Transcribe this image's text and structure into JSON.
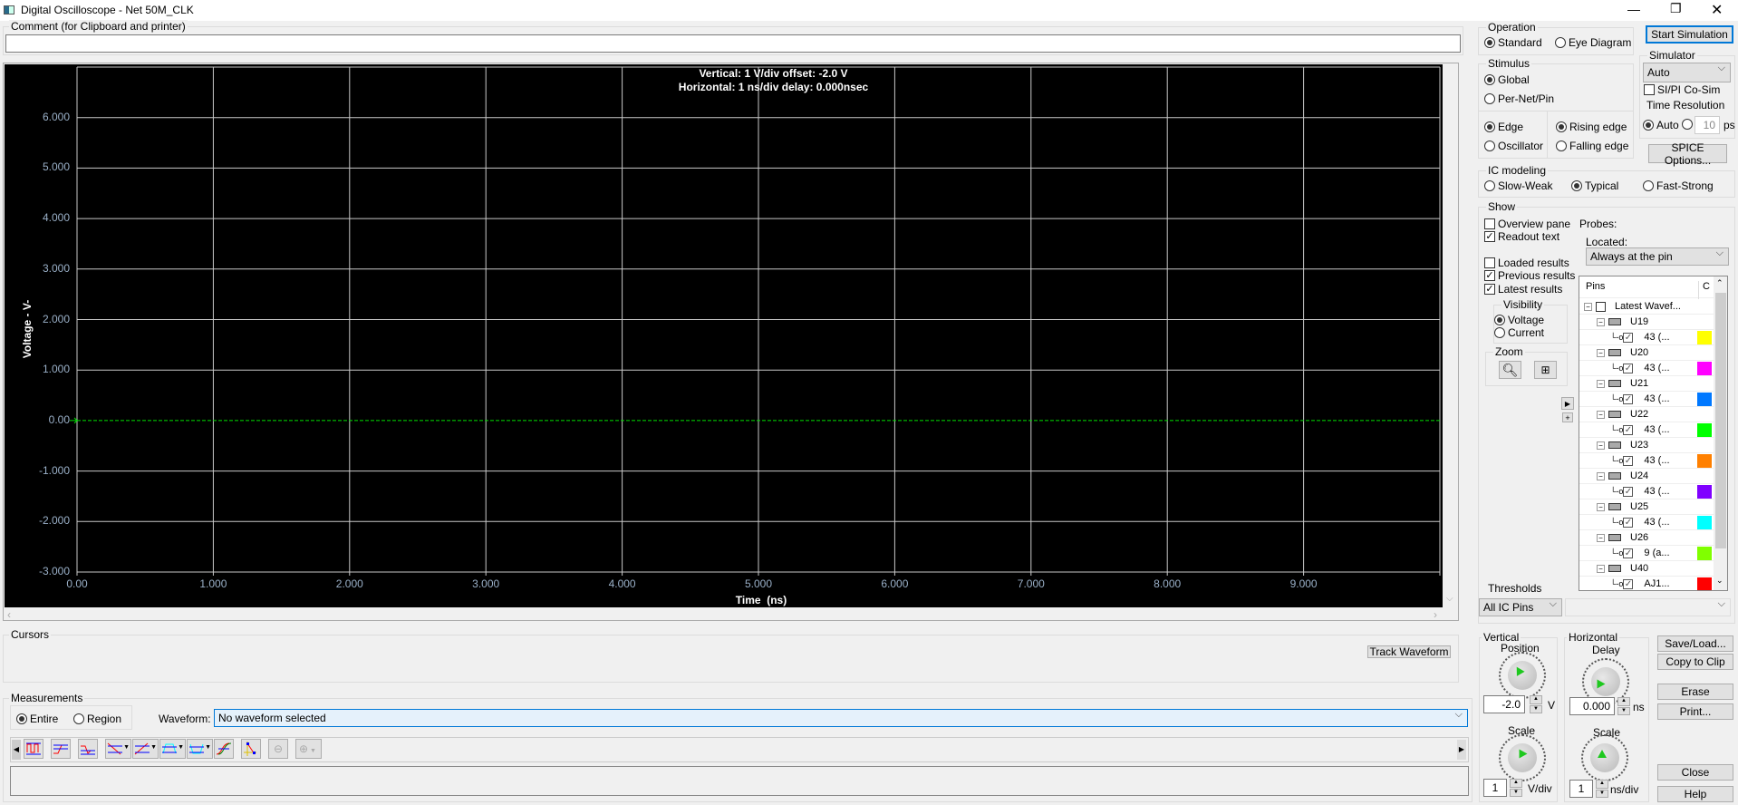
{
  "window": {
    "title": "Digital Oscilloscope - Net 50M_CLK"
  },
  "comment": {
    "label": "Comment (for Clipboard and printer)",
    "value": ""
  },
  "plot": {
    "readout_line1": "Vertical: 1  V/div  offset: -2.0 V",
    "readout_line2": "Horizontal: 1 ns/div  delay: 0.000nsec",
    "trace_color": "#00e000"
  },
  "chart_data": {
    "type": "line",
    "title": "",
    "xlabel": "Time  (ns)",
    "ylabel": "Voltage  - V-",
    "xlim": [
      0,
      10
    ],
    "ylim": [
      -3,
      7
    ],
    "x_ticks": [
      "0.00",
      "1.000",
      "2.000",
      "3.000",
      "4.000",
      "5.000",
      "6.000",
      "7.000",
      "8.000",
      "9.000"
    ],
    "y_ticks": [
      {
        "v": 6,
        "label": "6.000"
      },
      {
        "v": 5,
        "label": "5.000"
      },
      {
        "v": 4,
        "label": "4.000"
      },
      {
        "v": 3,
        "label": "3.000"
      },
      {
        "v": 2,
        "label": "2.000"
      },
      {
        "v": 1,
        "label": "1.000"
      },
      {
        "v": 0,
        "label": "0.00"
      },
      {
        "v": -1,
        "label": "-1.000"
      },
      {
        "v": -2,
        "label": "-2.000"
      },
      {
        "v": -3,
        "label": "-3.000"
      }
    ],
    "series": [
      {
        "name": "ground marker",
        "x": [
          0,
          10
        ],
        "y": [
          0,
          0
        ]
      }
    ],
    "grid": true
  },
  "operation": {
    "label": "Operation",
    "standard": "Standard",
    "eye": "Eye Diagram",
    "start": "Start Simulation"
  },
  "stimulus": {
    "label": "Stimulus",
    "global": "Global",
    "pernet": "Per-Net/Pin",
    "edge": "Edge",
    "osc": "Oscillator",
    "rising": "Rising edge",
    "falling": "Falling edge"
  },
  "simulator": {
    "label": "Simulator",
    "value": "Auto",
    "cosim": "SI/PI Co-Sim",
    "timeres": "Time Resolution",
    "auto": "Auto",
    "res_value": "10",
    "unit": "ps",
    "spice": "SPICE Options..."
  },
  "ic": {
    "label": "IC modeling",
    "slow": "Slow-Weak",
    "typ": "Typical",
    "fast": "Fast-Strong"
  },
  "show": {
    "label": "Show",
    "overview": "Overview pane",
    "readout": "Readout text",
    "loaded": "Loaded results",
    "previous": "Previous results",
    "latest": "Latest results",
    "probes": "Probes:",
    "located": "Located:",
    "located_value": "Always at the pin"
  },
  "visibility": {
    "label": "Visibility",
    "voltage": "Voltage",
    "current": "Current"
  },
  "zoom": {
    "label": "Zoom"
  },
  "tree": {
    "col_pins": "Pins",
    "col_c": "C",
    "root": "Latest Wavef...",
    "components": [
      {
        "name": "U19",
        "pin": "43 (...",
        "color": "#ffff00"
      },
      {
        "name": "U20",
        "pin": "43 (...",
        "color": "#ff00ff"
      },
      {
        "name": "U21",
        "pin": "43 (...",
        "color": "#0078ff"
      },
      {
        "name": "U22",
        "pin": "43 (...",
        "color": "#00ff00"
      },
      {
        "name": "U23",
        "pin": "43 (...",
        "color": "#ff8000"
      },
      {
        "name": "U24",
        "pin": "43 (...",
        "color": "#8000ff"
      },
      {
        "name": "U25",
        "pin": "43 (...",
        "color": "#00ffff"
      },
      {
        "name": "U26",
        "pin": "9 (a...",
        "color": "#80ff00"
      },
      {
        "name": "U40",
        "pin": "AJ1...",
        "color": "#ff0000"
      }
    ]
  },
  "thresholds": {
    "label": "Thresholds",
    "value": "All IC Pins"
  },
  "cursors": {
    "label": "Cursors",
    "track": "Track Waveform"
  },
  "measurements": {
    "label": "Measurements",
    "entire": "Entire",
    "region": "Region",
    "waveform_label": "Waveform:",
    "waveform_value": "No waveform selected"
  },
  "vertical": {
    "label": "Vertical",
    "position": "Position",
    "pos_value": "-2.0",
    "pos_unit": "V",
    "scale": "Scale",
    "scale_value": "1",
    "scale_unit": "V/div"
  },
  "horizontal": {
    "label": "Horizontal",
    "delay": "Delay",
    "delay_value": "0.000",
    "delay_unit": "ns",
    "scale": "Scale",
    "scale_value": "1",
    "scale_unit": "ns/div"
  },
  "buttons": {
    "save": "Save/Load...",
    "copy": "Copy to Clip",
    "erase": "Erase",
    "print": "Print...",
    "close": "Close",
    "help": "Help"
  }
}
